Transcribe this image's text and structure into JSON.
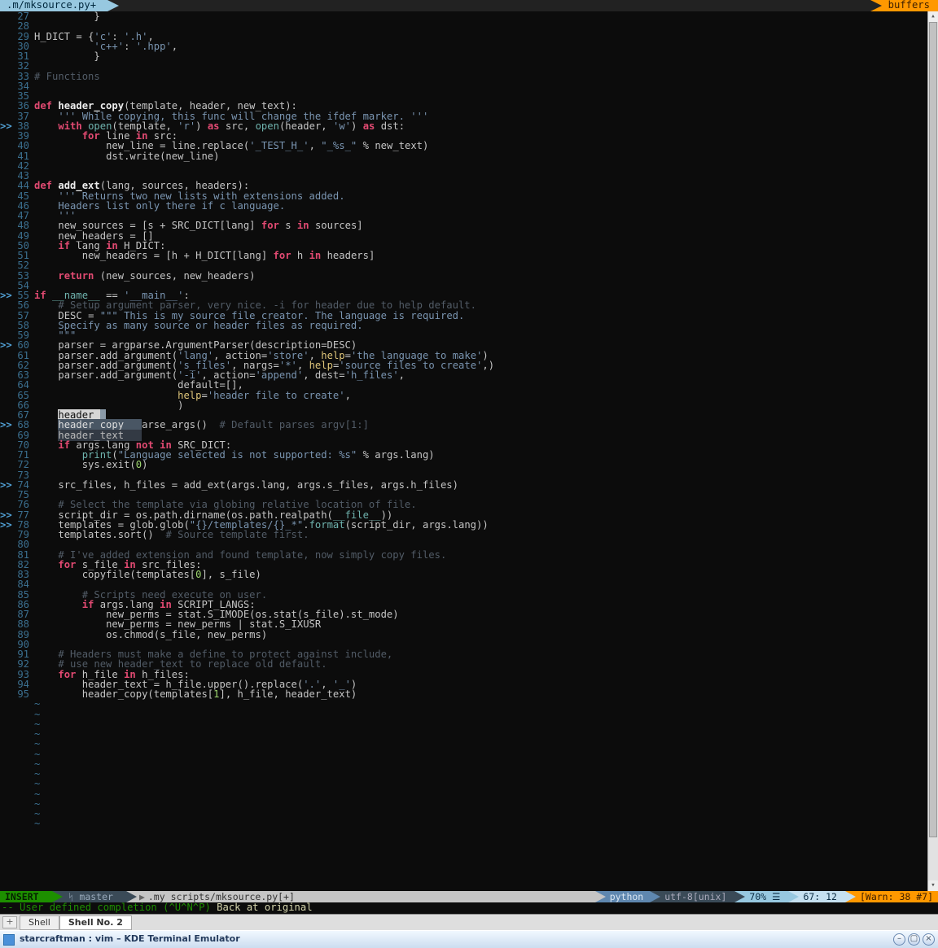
{
  "tabs": {
    "left": ".m/mksource.py+",
    "right": "buffers"
  },
  "gutter": {
    "start": 27,
    "end": 95,
    "marks": [
      38,
      55,
      60,
      68,
      74,
      77,
      78
    ]
  },
  "code": [
    {
      "n": 27,
      "html": "          <span class='pu'>}</span>"
    },
    {
      "n": 28,
      "html": ""
    },
    {
      "n": 29,
      "html": "<span class='id'>H_DICT</span> <span class='pu'>=</span> <span class='pu'>{</span><span class='str'>'c'</span><span class='pu'>:</span> <span class='str'>'.h'</span><span class='pu'>,</span>"
    },
    {
      "n": 30,
      "html": "          <span class='str'>'c++'</span><span class='pu'>:</span> <span class='str'>'.hpp'</span><span class='pu'>,</span>"
    },
    {
      "n": 31,
      "html": "          <span class='pu'>}</span>"
    },
    {
      "n": 32,
      "html": ""
    },
    {
      "n": 33,
      "html": "<span class='cm2'># Functions</span>"
    },
    {
      "n": 34,
      "html": ""
    },
    {
      "n": 35,
      "html": ""
    },
    {
      "n": 36,
      "html": "<span class='kw'>def</span> <span class='fn'>header_copy</span><span class='pu'>(template, header, new_text):</span>"
    },
    {
      "n": 37,
      "html": "    <span class='str'>''' While copying, this func will change the ifdef marker. '''</span>"
    },
    {
      "n": 38,
      "html": "    <span class='kw'>with</span> <span class='bltin'>open</span><span class='pu'>(template,</span> <span class='str'>'r'</span><span class='pu'>)</span> <span class='kw'>as</span> <span class='id'>src</span><span class='pu'>,</span> <span class='bltin'>open</span><span class='pu'>(header,</span> <span class='str'>'w'</span><span class='pu'>)</span> <span class='kw'>as</span> <span class='id'>dst:</span>"
    },
    {
      "n": 39,
      "html": "        <span class='kw'>for</span> <span class='id'>line</span> <span class='kw'>in</span> <span class='id'>src:</span>"
    },
    {
      "n": 40,
      "html": "            <span class='id'>new_line</span> <span class='pu'>=</span> <span class='id'>line.replace(</span><span class='str'>'_TEST_H_'</span><span class='pu'>,</span> <span class='str'>\"_%s_\"</span> <span class='pu'>%</span> <span class='id'>new_text)</span>"
    },
    {
      "n": 41,
      "html": "            <span class='id'>dst.write(new_line)</span>"
    },
    {
      "n": 42,
      "html": ""
    },
    {
      "n": 43,
      "html": ""
    },
    {
      "n": 44,
      "html": "<span class='kw'>def</span> <span class='fn'>add_ext</span><span class='pu'>(lang, sources, headers):</span>"
    },
    {
      "n": 45,
      "html": "    <span class='str'>''' Returns two new lists with extensions added.</span>"
    },
    {
      "n": 46,
      "html": "<span class='str'>    Headers list only there if c language.</span>"
    },
    {
      "n": 47,
      "html": "<span class='str'>    '''</span>"
    },
    {
      "n": 48,
      "html": "    <span class='id'>new_sources</span> <span class='pu'>= [s + SRC_DICT[lang]</span> <span class='kw'>for</span> <span class='id'>s</span> <span class='kw'>in</span> <span class='id'>sources]</span>"
    },
    {
      "n": 49,
      "html": "    <span class='id'>new_headers = []</span>"
    },
    {
      "n": 50,
      "html": "    <span class='kw'>if</span> <span class='id'>lang</span> <span class='kw'>in</span> <span class='id'>H_DICT:</span>"
    },
    {
      "n": 51,
      "html": "        <span class='id'>new_headers = [h + H_DICT[lang]</span> <span class='kw'>for</span> <span class='id'>h</span> <span class='kw'>in</span> <span class='id'>headers]</span>"
    },
    {
      "n": 52,
      "html": ""
    },
    {
      "n": 53,
      "html": "    <span class='kw'>return</span> <span class='id'>(new_sources, new_headers)</span>"
    },
    {
      "n": 54,
      "html": ""
    },
    {
      "n": 55,
      "html": "<span class='kw'>if</span> <span class='bltin'>__name__</span> <span class='pu'>==</span> <span class='str'>'__main__'</span><span class='pu'>:</span>"
    },
    {
      "n": 56,
      "html": "    <span class='cm2'># Setup argument parser, very nice. -i for header due to help default.</span>"
    },
    {
      "n": 57,
      "html": "    <span class='id'>DESC</span> <span class='pu'>=</span> <span class='str'>\"\"\" This is my source file creator. The language is required.</span>"
    },
    {
      "n": 58,
      "html": "<span class='str'>    Specify as many source or header files as required.</span>"
    },
    {
      "n": 59,
      "html": "<span class='str'>    \"\"\"</span>"
    },
    {
      "n": 60,
      "html": "    <span class='id'>parser = argparse.ArgumentParser(description=DESC)</span>"
    },
    {
      "n": 61,
      "html": "    <span class='id'>parser.add_argument(</span><span class='str'>'lang'</span><span class='pu'>,</span> <span class='id'>action</span><span class='pu'>=</span><span class='str'>'store'</span><span class='pu'>,</span> <span class='bi'>help</span><span class='pu'>=</span><span class='str'>'the language to make'</span><span class='pu'>)</span>"
    },
    {
      "n": 62,
      "html": "    <span class='id'>parser.add_argument(</span><span class='str'>'s_files'</span><span class='pu'>,</span> <span class='id'>nargs</span><span class='pu'>=</span><span class='str'>'*'</span><span class='pu'>,</span> <span class='bi'>help</span><span class='pu'>=</span><span class='str'>'source files to create'</span><span class='pu'>,)</span>"
    },
    {
      "n": 63,
      "html": "    <span class='id'>parser.add_argument(</span><span class='str'>'-i'</span><span class='pu'>,</span> <span class='id'>action</span><span class='pu'>=</span><span class='str'>'append'</span><span class='pu'>,</span> <span class='id'>dest</span><span class='pu'>=</span><span class='str'>'h_files'</span><span class='pu'>,</span>"
    },
    {
      "n": 64,
      "html": "                        <span class='id'>default=[],</span>"
    },
    {
      "n": 65,
      "html": "                        <span class='bi'>help</span><span class='pu'>=</span><span class='str'>'header file to create'</span><span class='pu'>,</span>"
    },
    {
      "n": 66,
      "html": "                        <span class='pu'>)</span>"
    },
    {
      "n": 67,
      "html": "    <span class='cur'>header_</span><span class='cursor'> </span>"
    },
    {
      "n": 68,
      "html": "    <span class='popsel'>header_copy   </span><span class='pu'>arse_args()</span>  <span class='cm2'># Default parses argv[1:]</span>"
    },
    {
      "n": 69,
      "html": "    <span class='pop'>header_text   </span>"
    },
    {
      "n": 70,
      "html": "    <span class='kw'>if</span> <span class='id'>args.lang</span> <span class='kw'>not</span> <span class='kw'>in</span> <span class='id'>SRC_DICT:</span>"
    },
    {
      "n": 71,
      "html": "        <span class='bltin'>print</span><span class='pu'>(</span><span class='str'>\"Language selected is not supported: %s\"</span> <span class='pu'>%</span> <span class='id'>args.lang)</span>"
    },
    {
      "n": 72,
      "html": "        <span class='id'>sys.exit(</span><span class='num'>0</span><span class='pu'>)</span>"
    },
    {
      "n": 73,
      "html": ""
    },
    {
      "n": 74,
      "html": "    <span class='id'>src_files, h_files = add_ext(args.lang, args.s_files, args.h_files)</span>"
    },
    {
      "n": 75,
      "html": ""
    },
    {
      "n": 76,
      "html": "    <span class='cm2'># Select the template via globing relative location of file.</span>"
    },
    {
      "n": 77,
      "html": "    <span class='id'>script_dir = os.path.dirname(os.path.realpath(</span><span class='bltin'>__file__</span><span class='id'>))</span>"
    },
    {
      "n": 78,
      "html": "    <span class='id'>templates = glob.glob(</span><span class='str'>\"{}/templates/{}_*\"</span><span class='id'>.</span><span class='bltin'>format</span><span class='id'>(script_dir, args.lang))</span>"
    },
    {
      "n": 79,
      "html": "    <span class='id'>templates.sort()</span>  <span class='cm2'># Source template first.</span>"
    },
    {
      "n": 80,
      "html": ""
    },
    {
      "n": 81,
      "html": "    <span class='cm2'># I've added extension and found template, now simply copy files.</span>"
    },
    {
      "n": 82,
      "html": "    <span class='kw'>for</span> <span class='id'>s_file</span> <span class='kw'>in</span> <span class='id'>src_files:</span>"
    },
    {
      "n": 83,
      "html": "        <span class='id'>copyfile(templates[</span><span class='num'>0</span><span class='id'>], s_file)</span>"
    },
    {
      "n": 84,
      "html": ""
    },
    {
      "n": 85,
      "html": "        <span class='cm2'># Scripts need execute on user.</span>"
    },
    {
      "n": 86,
      "html": "        <span class='kw'>if</span> <span class='id'>args.lang</span> <span class='kw'>in</span> <span class='id'>SCRIPT_LANGS:</span>"
    },
    {
      "n": 87,
      "html": "            <span class='id'>new_perms = stat.S_IMODE(os.stat(s_file).st_mode)</span>"
    },
    {
      "n": 88,
      "html": "            <span class='id'>new_perms = new_perms | stat.S_IXUSR</span>"
    },
    {
      "n": 89,
      "html": "            <span class='id'>os.chmod(s_file, new_perms)</span>"
    },
    {
      "n": 90,
      "html": ""
    },
    {
      "n": 91,
      "html": "    <span class='cm2'># Headers must make a define to protect against include,</span>"
    },
    {
      "n": 92,
      "html": "    <span class='cm2'># use new header_text to replace old default.</span>"
    },
    {
      "n": 93,
      "html": "    <span class='kw'>for</span> <span class='id'>h_file</span> <span class='kw'>in</span> <span class='id'>h_files:</span>"
    },
    {
      "n": 94,
      "html": "        <span class='id'>header_text = h_file.upper().replace(</span><span class='str'>'.'</span><span class='pu'>,</span> <span class='str'>'_'</span><span class='id'>)</span>"
    },
    {
      "n": 95,
      "html": "        <span class='id'>header_copy(templates[</span><span class='num'>1</span><span class='id'>], h_file, header_text)</span>"
    }
  ],
  "tildes": 13,
  "statusline": {
    "mode": "INSERT",
    "branch_icon": "ᛋ",
    "branch": "master",
    "file": ".my scripts/mksource.py[+]",
    "filetype": "python",
    "encoding": "utf-8[unix]",
    "percent": "70%",
    "ln_icon": "☰",
    "position": "67: 12",
    "warn": "[Warn: 38 #7]"
  },
  "cmdline": {
    "msg1": "-- User defined completion (^U^N^P) ",
    "msg2": "Back at original"
  },
  "termtabs": {
    "new": "+",
    "tabs": [
      {
        "label": "Shell",
        "active": false
      },
      {
        "label": "Shell No. 2",
        "active": true
      }
    ]
  },
  "titlebar": {
    "title": "starcraftman : vim – KDE Terminal Emulator"
  }
}
